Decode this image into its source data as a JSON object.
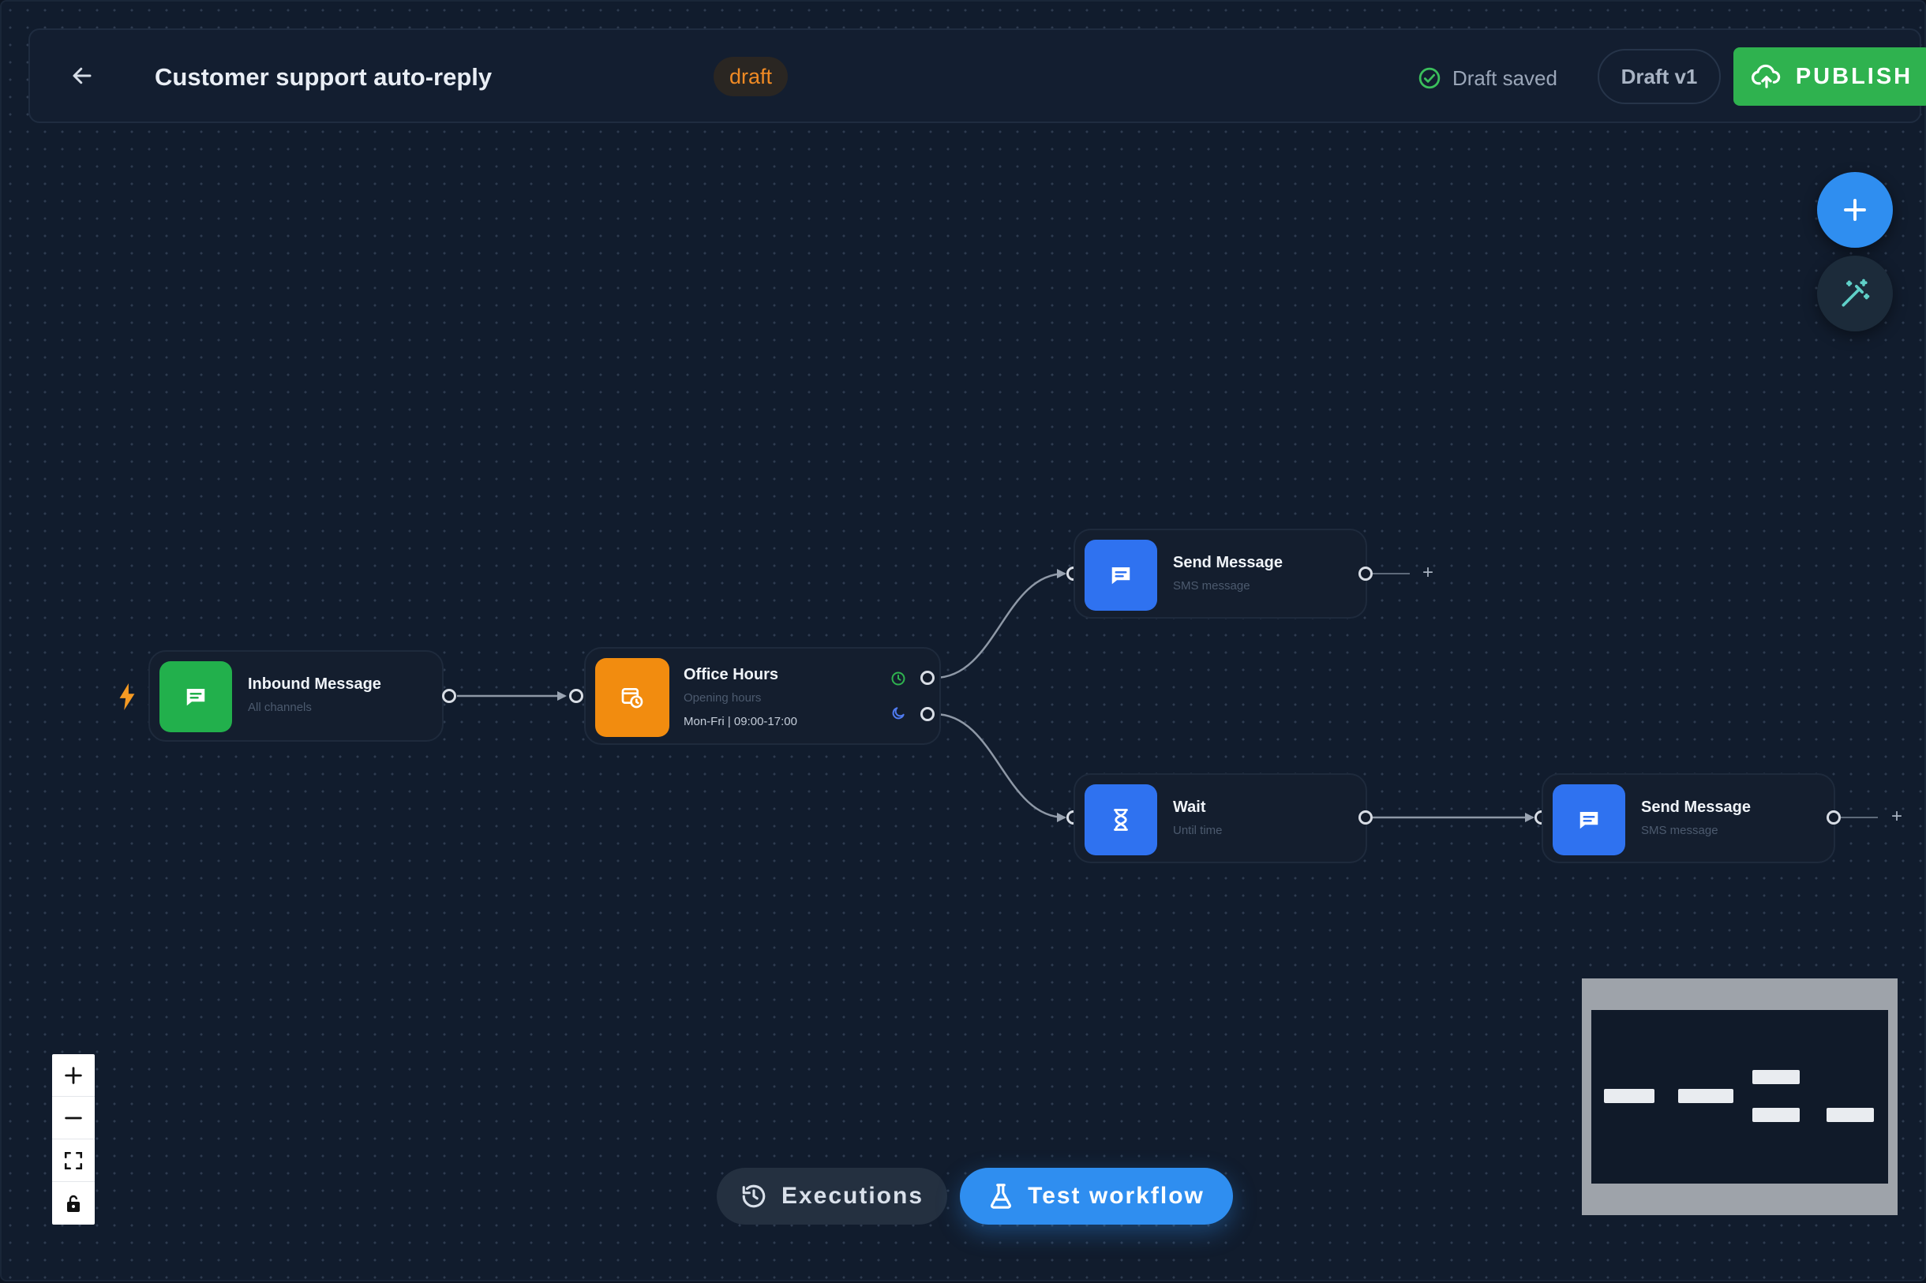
{
  "header": {
    "back_icon": "arrow-left-icon",
    "title": "Customer support auto-reply",
    "status_badge": "draft",
    "save_status": "Draft saved",
    "save_icon": "check-circle-icon",
    "version_label": "Draft v1",
    "publish_label": "PUBLISH",
    "publish_icon": "cloud-upload-icon"
  },
  "fab": {
    "add_icon": "plus-icon",
    "magic_icon": "magic-wand-icon"
  },
  "nodes": {
    "inbound": {
      "title": "Inbound Message",
      "subtitle": "All channels",
      "icon": "message-icon",
      "trigger_icon": "bolt-icon",
      "color": "#22b04c"
    },
    "office": {
      "title": "Office Hours",
      "subtitle": "Opening hours",
      "detail": "Mon-Fri | 09:00-17:00",
      "icon": "calendar-clock-icon",
      "color": "#f28c0f",
      "open_icon": "clock-icon",
      "closed_icon": "moon-icon"
    },
    "send1": {
      "title": "Send Message",
      "subtitle": "SMS message",
      "icon": "message-icon",
      "color": "#2f72f0"
    },
    "wait": {
      "title": "Wait",
      "subtitle": "Until time",
      "icon": "hourglass-icon",
      "color": "#2f72f0"
    },
    "send2": {
      "title": "Send Message",
      "subtitle": "SMS message",
      "icon": "message-icon",
      "color": "#2f72f0"
    }
  },
  "add_after_symbol": "+",
  "zoom_controls": [
    "zoom-in-icon",
    "zoom-out-icon",
    "fit-view-icon",
    "lock-icon"
  ],
  "bottom": {
    "executions_label": "Executions",
    "executions_icon": "history-icon",
    "test_label": "Test workflow",
    "test_icon": "flask-icon"
  },
  "colors": {
    "canvas": "#111c2d",
    "accent_blue": "#2f8ef0",
    "publish_green": "#2fb24f",
    "draft_orange": "#f08a24"
  }
}
